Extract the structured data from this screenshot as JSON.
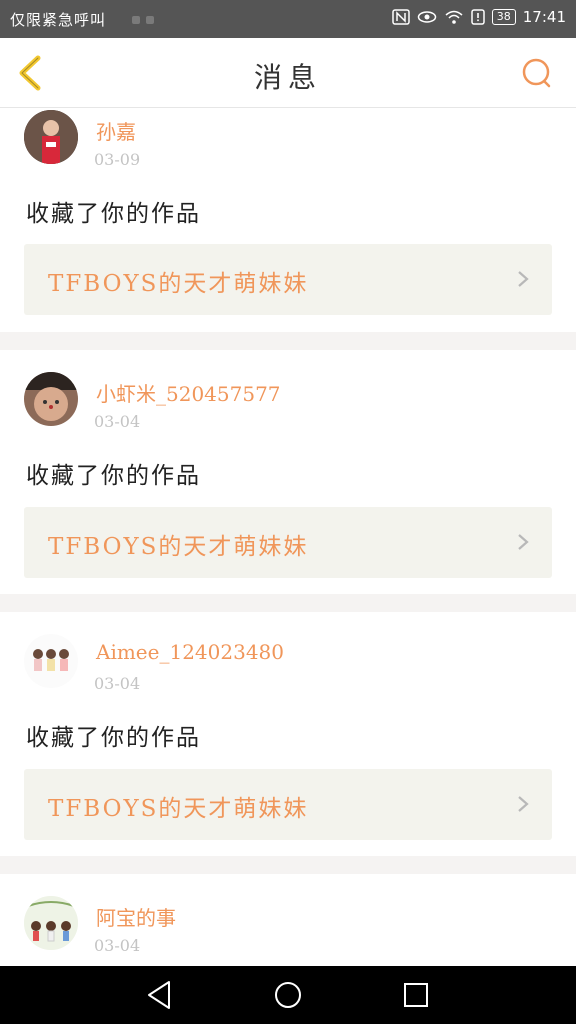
{
  "status_bar": {
    "carrier_text": "仅限紧急呼叫",
    "battery": "38",
    "time": "17:41"
  },
  "header": {
    "title": "消息"
  },
  "messages": [
    {
      "name": "孙嘉",
      "date": "03-09",
      "action": "收藏了你的作品",
      "work_title": "TFBOYS的天才萌妹妹"
    },
    {
      "name": "小虾米_520457577",
      "date": "03-04",
      "action": "收藏了你的作品",
      "work_title": "TFBOYS的天才萌妹妹"
    },
    {
      "name": "Aimee_124023480",
      "date": "03-04",
      "action": "收藏了你的作品",
      "work_title": "TFBOYS的天才萌妹妹"
    },
    {
      "name": "阿宝的事",
      "date": "03-04"
    }
  ],
  "colors": {
    "accent": "#f0965a",
    "back_arrow": "#f2c830",
    "status_bar": "#555555",
    "work_box": "#f3f3ed"
  }
}
